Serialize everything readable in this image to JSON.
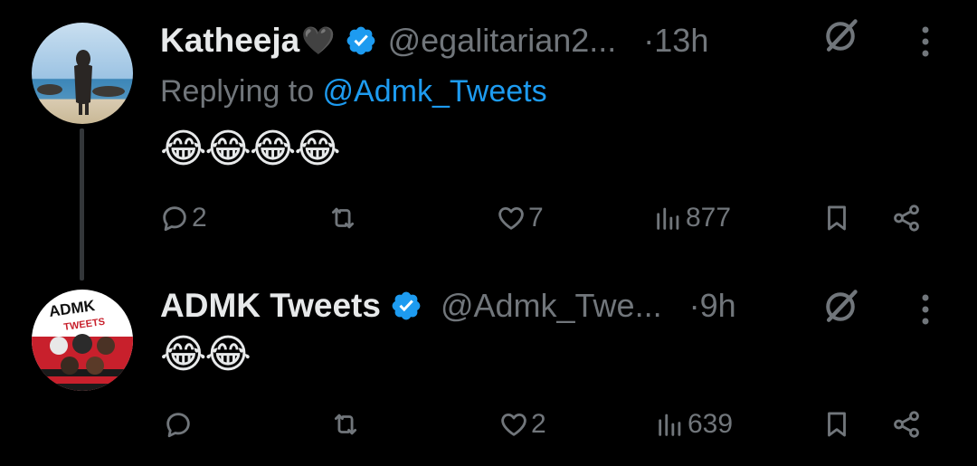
{
  "thread": [
    {
      "author_name": "Katheeja",
      "name_emoji": "🖤",
      "handle": "@egalitarian2...",
      "time": "·13h",
      "replying_prefix": "Replying to ",
      "replying_to": "@Admk_Tweets",
      "text": "😂😂😂😂",
      "replies": "2",
      "retweets": "",
      "likes": "7",
      "views": "877",
      "verified": true,
      "icons": [
        "avatar",
        "verified-icon",
        "grok-icon",
        "more-icon",
        "reply-icon",
        "retweet-icon",
        "like-icon",
        "views-icon",
        "bookmark-icon",
        "share-icon"
      ]
    },
    {
      "author_name": "ADMK Tweets",
      "avatar_text": "ADMK",
      "avatar_subtext": "TWEETS",
      "handle": "@Admk_Twe...",
      "time": "·9h",
      "text": "😂😂",
      "replies": "",
      "retweets": "",
      "likes": "2",
      "views": "639",
      "verified": true
    }
  ],
  "colors": {
    "background": "#000000",
    "primary_text": "#e7e9ea",
    "secondary_text": "#71767b",
    "accent": "#1d9bf0",
    "thread_line": "#333639"
  }
}
